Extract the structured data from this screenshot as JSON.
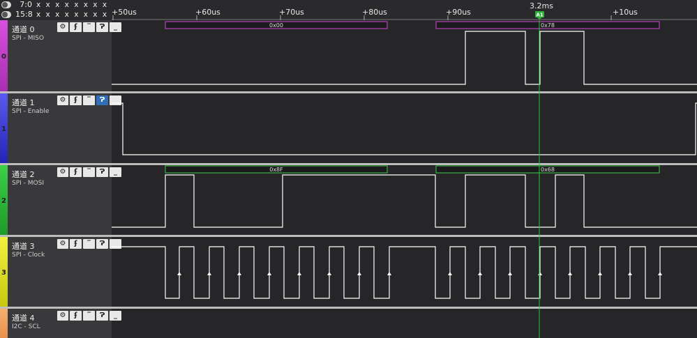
{
  "top_left": {
    "rows": [
      {
        "label": "7:0",
        "values": "x x x x x x x x"
      },
      {
        "label": "15:8",
        "values": "x x x x x x x x"
      }
    ]
  },
  "timeline": {
    "ticks": [
      "+50us",
      "+60us",
      "+70us",
      "+80us",
      "+90us",
      "+10us"
    ],
    "marker_time": "3.2ms",
    "marker_label": "A1"
  },
  "colors": {
    "ch0": "#c93ccf",
    "ch1": "#3a3ad8",
    "ch2": "#2fb23a",
    "ch3": "#e8e820",
    "ch4": "#f2a15a",
    "waveform": "#ffffff",
    "marker": "#22cc33",
    "miso_box": "#d04ad8",
    "mosi_box": "#3fcc4a"
  },
  "channels": [
    {
      "number": "0",
      "name": "通道 0",
      "sub": "SPI - MISO",
      "side_num": "0",
      "controls": [
        "gear-icon",
        "rising-edge-icon",
        "high-level-icon",
        "falling-edge-icon",
        "low-level-icon"
      ],
      "decodes": [
        "0x00",
        "0x78"
      ]
    },
    {
      "number": "1",
      "name": "通道 1",
      "sub": "SPI - Enable",
      "side_num": "1",
      "controls": [
        "gear-icon",
        "rising-edge-icon",
        "high-level-icon",
        "falling-edge-icon",
        "low-level-icon"
      ],
      "decodes": []
    },
    {
      "number": "2",
      "name": "通道 2",
      "sub": "SPI - MOSI",
      "side_num": "2",
      "controls": [
        "gear-icon",
        "rising-edge-icon",
        "high-level-icon",
        "falling-edge-icon",
        "low-level-icon"
      ],
      "decodes": [
        "0x8F",
        "0x68"
      ]
    },
    {
      "number": "3",
      "name": "通道 3",
      "sub": "SPI - Clock",
      "side_num": "3",
      "controls": [
        "gear-icon",
        "rising-edge-icon",
        "high-level-icon",
        "falling-edge-icon",
        "low-level-icon"
      ],
      "decodes": []
    },
    {
      "number": "4",
      "name": "通道 4",
      "sub": "I2C - SCL",
      "side_num": "",
      "controls": [
        "gear-icon",
        "rising-edge-icon",
        "high-level-icon",
        "falling-edge-icon",
        "low-level-icon"
      ],
      "decodes": []
    }
  ]
}
